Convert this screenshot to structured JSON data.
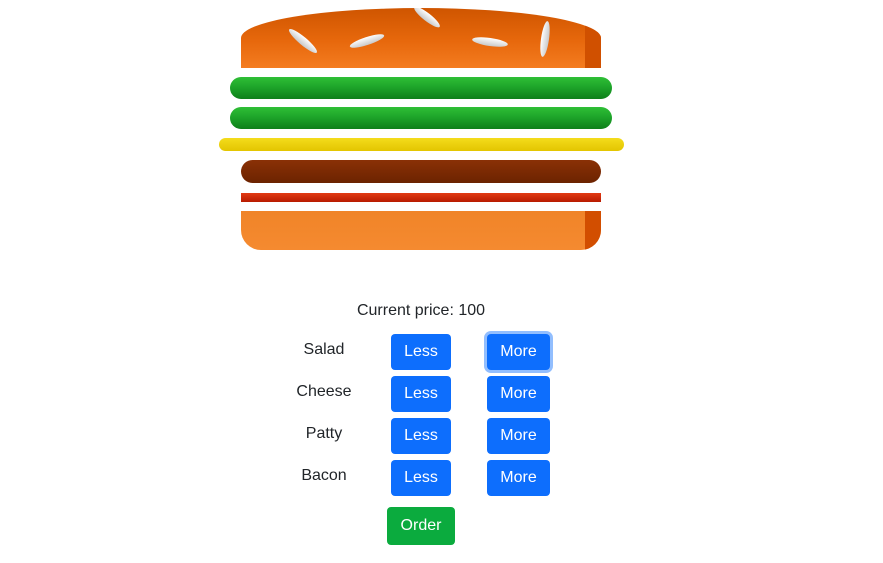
{
  "burger": {
    "layers": [
      "seeds",
      "salad",
      "salad",
      "cheese",
      "patty",
      "bacon"
    ]
  },
  "price": {
    "text": "Current price: 100"
  },
  "ingredients": [
    {
      "label": "Salad",
      "less": "Less",
      "more": "More"
    },
    {
      "label": "Cheese",
      "less": "Less",
      "more": "More"
    },
    {
      "label": "Patty",
      "less": "Less",
      "more": "More"
    },
    {
      "label": "Bacon",
      "less": "Less",
      "more": "More"
    }
  ],
  "order_button": "Order",
  "colors": {
    "primary": "#0d6efd",
    "success": "#0bab3e",
    "bun": "#e7680c",
    "salad": "#1ea52a",
    "cheese": "#f0d210",
    "patty": "#7a2a03",
    "bacon": "#cc2a0a"
  }
}
